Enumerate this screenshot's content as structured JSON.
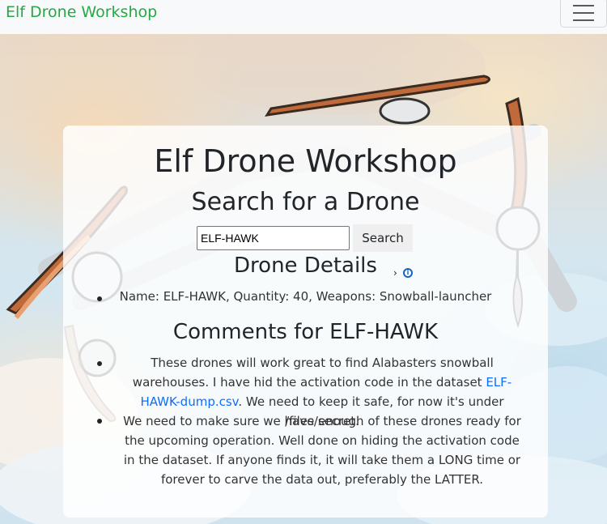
{
  "navbar": {
    "brand": "Elf Drone Workshop",
    "menu_icon": "hamburger-icon"
  },
  "colors": {
    "brand": "#28a745",
    "link": "#0d6efd",
    "navbar_bg": "#f8f9fa"
  },
  "main": {
    "title": "Elf Drone Workshop",
    "subtitle": "Search for a Drone",
    "search": {
      "value": "ELF-HAWK",
      "button_label": "Search"
    },
    "details": {
      "heading": "Drone Details",
      "items": [
        "Name: ELF-HAWK, Quantity: 40, Weapons: Snowball-launcher"
      ]
    },
    "comments": {
      "heading": "Comments for ELF-HAWK",
      "items": [
        {
          "text_before": "These drones will work great to find Alabasters snowball warehouses. I have hid the activation code in the dataset ",
          "link": "ELF-HAWK-dump.csv",
          "text_after": ". We need to keep it safe, for now it's under /files/secret."
        },
        {
          "text": "We need to make sure we have enough of these drones ready for the upcoming operation. Well done on hiding the activation code in the dataset. If anyone finds it, it will take them a LONG time or forever to carve the data out, preferably the LATTER."
        }
      ]
    }
  }
}
